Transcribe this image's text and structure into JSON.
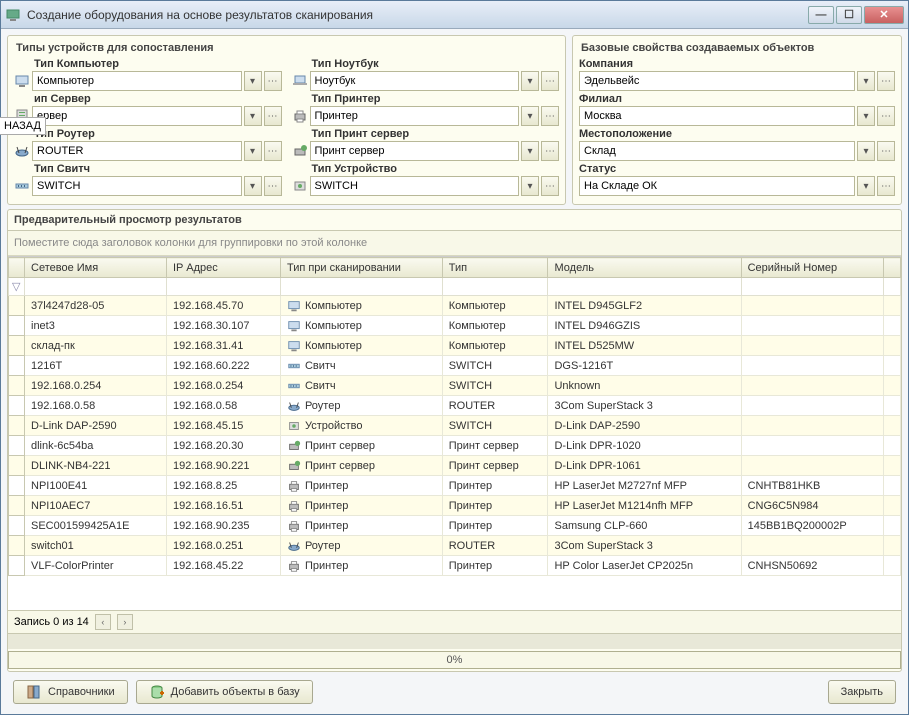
{
  "window": {
    "title": "Создание оборудования на основе результатов сканирования"
  },
  "back_tooltip": "НАЗАД",
  "devtypes": {
    "title": "Типы устройств для сопоставления",
    "fields": [
      {
        "label": "Тип Компьютер",
        "value": "Компьютер",
        "icon": "computer"
      },
      {
        "label": "Тип Ноутбук",
        "value": "Ноутбук",
        "icon": "laptop"
      },
      {
        "label": "ип Сервер",
        "value": "ервер",
        "icon": "server"
      },
      {
        "label": "Тип Принтер",
        "value": "Принтер",
        "icon": "printer"
      },
      {
        "label": "Тип Роутер",
        "value": "ROUTER",
        "icon": "router"
      },
      {
        "label": "Тип Принт сервер",
        "value": "Принт сервер",
        "icon": "printserver"
      },
      {
        "label": "Тип Свитч",
        "value": "SWITCH",
        "icon": "switch"
      },
      {
        "label": "Тип Устройство",
        "value": "SWITCH",
        "icon": "device"
      }
    ]
  },
  "baseprops": {
    "title": "Базовые свойства создаваемых объектов",
    "fields": [
      {
        "label": "Компания",
        "value": "Эдельвейс"
      },
      {
        "label": "Филиал",
        "value": "Москва"
      },
      {
        "label": "Местоположение",
        "value": "Склад"
      },
      {
        "label": "Статус",
        "value": "На Складе ОК"
      }
    ]
  },
  "preview": {
    "title": "Предварительный просмотр результатов",
    "group_hint": "Поместите сюда заголовок колонки для группировки по этой колонке",
    "columns": [
      "Сетевое Имя",
      "IP Адрес",
      "Тип при сканировании",
      "Тип",
      "Модель",
      "Серийный Номер"
    ],
    "rows": [
      {
        "name": "37l4247d28-05",
        "ip": "192.168.45.70",
        "scantype": "Компьютер",
        "icon": "computer",
        "type": "Компьютер",
        "model": "INTEL D945GLF2",
        "serial": ""
      },
      {
        "name": "inet3",
        "ip": "192.168.30.107",
        "scantype": "Компьютер",
        "icon": "computer",
        "type": "Компьютер",
        "model": "INTEL D946GZIS",
        "serial": ""
      },
      {
        "name": "склад-пк",
        "ip": "192.168.31.41",
        "scantype": "Компьютер",
        "icon": "computer",
        "type": "Компьютер",
        "model": "INTEL D525MW",
        "serial": ""
      },
      {
        "name": "1216T",
        "ip": "192.168.60.222",
        "scantype": "Свитч",
        "icon": "switch",
        "type": "SWITCH",
        "model": "DGS-1216T",
        "serial": ""
      },
      {
        "name": "192.168.0.254",
        "ip": "192.168.0.254",
        "scantype": "Свитч",
        "icon": "switch",
        "type": "SWITCH",
        "model": "Unknown",
        "serial": ""
      },
      {
        "name": "192.168.0.58",
        "ip": "192.168.0.58",
        "scantype": "Роутер",
        "icon": "router",
        "type": "ROUTER",
        "model": "3Com SuperStack 3",
        "serial": ""
      },
      {
        "name": "D-Link DAP-2590",
        "ip": "192.168.45.15",
        "scantype": "Устройство",
        "icon": "device",
        "type": "SWITCH",
        "model": "D-Link DAP-2590",
        "serial": ""
      },
      {
        "name": "dlink-6c54ba",
        "ip": "192.168.20.30",
        "scantype": "Принт сервер",
        "icon": "printserver",
        "type": "Принт сервер",
        "model": "D-Link DPR-1020",
        "serial": ""
      },
      {
        "name": "DLINK-NB4-221",
        "ip": "192.168.90.221",
        "scantype": "Принт сервер",
        "icon": "printserver",
        "type": "Принт сервер",
        "model": "D-Link DPR-1061",
        "serial": ""
      },
      {
        "name": "NPI100E41",
        "ip": "192.168.8.25",
        "scantype": "Принтер",
        "icon": "printer",
        "type": "Принтер",
        "model": "HP LaserJet M2727nf MFP",
        "serial": "CNHTB81HKB"
      },
      {
        "name": "NPI10AEC7",
        "ip": "192.168.16.51",
        "scantype": "Принтер",
        "icon": "printer",
        "type": "Принтер",
        "model": "HP LaserJet M1214nfh MFP",
        "serial": "CNG6C5N984"
      },
      {
        "name": "SEC001599425A1E",
        "ip": "192.168.90.235",
        "scantype": "Принтер",
        "icon": "printer",
        "type": "Принтер",
        "model": "Samsung CLP-660",
        "serial": "145BB1BQ200002P"
      },
      {
        "name": "switch01",
        "ip": "192.168.0.251",
        "scantype": "Роутер",
        "icon": "router",
        "type": "ROUTER",
        "model": "3Com SuperStack 3",
        "serial": ""
      },
      {
        "name": "VLF-ColorPrinter",
        "ip": "192.168.45.22",
        "scantype": "Принтер",
        "icon": "printer",
        "type": "Принтер",
        "model": "HP Color LaserJet CP2025n",
        "serial": "CNHSN50692"
      }
    ],
    "record_label": "Запись 0 из 14",
    "progress": "0%"
  },
  "buttons": {
    "references": "Справочники",
    "add_objects": "Добавить объекты в базу",
    "close": "Закрыть"
  }
}
